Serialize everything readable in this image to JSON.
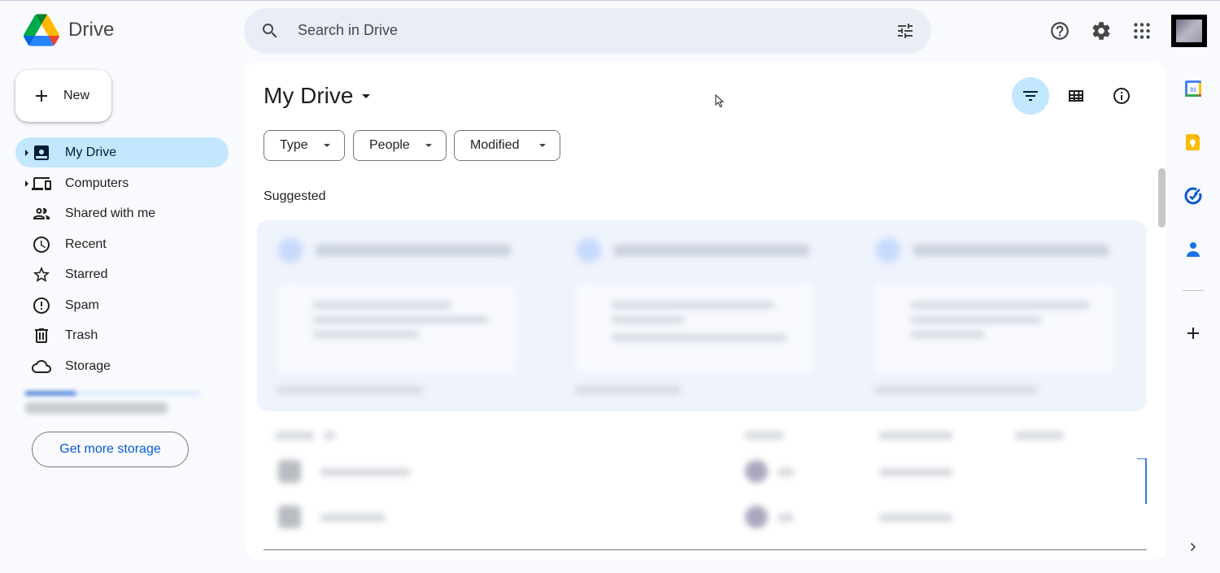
{
  "app": {
    "name": "Drive"
  },
  "search": {
    "placeholder": "Search in Drive"
  },
  "new_button": {
    "label": "New"
  },
  "sidebar": {
    "items": [
      {
        "label": "My Drive",
        "icon": "my-drive-icon",
        "active": true,
        "expandable": true
      },
      {
        "label": "Computers",
        "icon": "computers-icon",
        "active": false,
        "expandable": true
      },
      {
        "label": "Shared with me",
        "icon": "shared-icon",
        "active": false
      },
      {
        "label": "Recent",
        "icon": "clock-icon",
        "active": false
      },
      {
        "label": "Starred",
        "icon": "star-icon",
        "active": false
      },
      {
        "label": "Spam",
        "icon": "spam-icon",
        "active": false
      },
      {
        "label": "Trash",
        "icon": "trash-icon",
        "active": false
      },
      {
        "label": "Storage",
        "icon": "cloud-icon",
        "active": false
      }
    ],
    "get_storage": "Get more storage"
  },
  "main": {
    "title": "My Drive",
    "filters": [
      "Type",
      "People",
      "Modified"
    ],
    "section_label": "Suggested"
  },
  "colors": {
    "accent": "#0b57d0",
    "active_bg": "#c2e7ff",
    "search_bg": "#e9eef6",
    "page_bg": "#f8fafd"
  }
}
